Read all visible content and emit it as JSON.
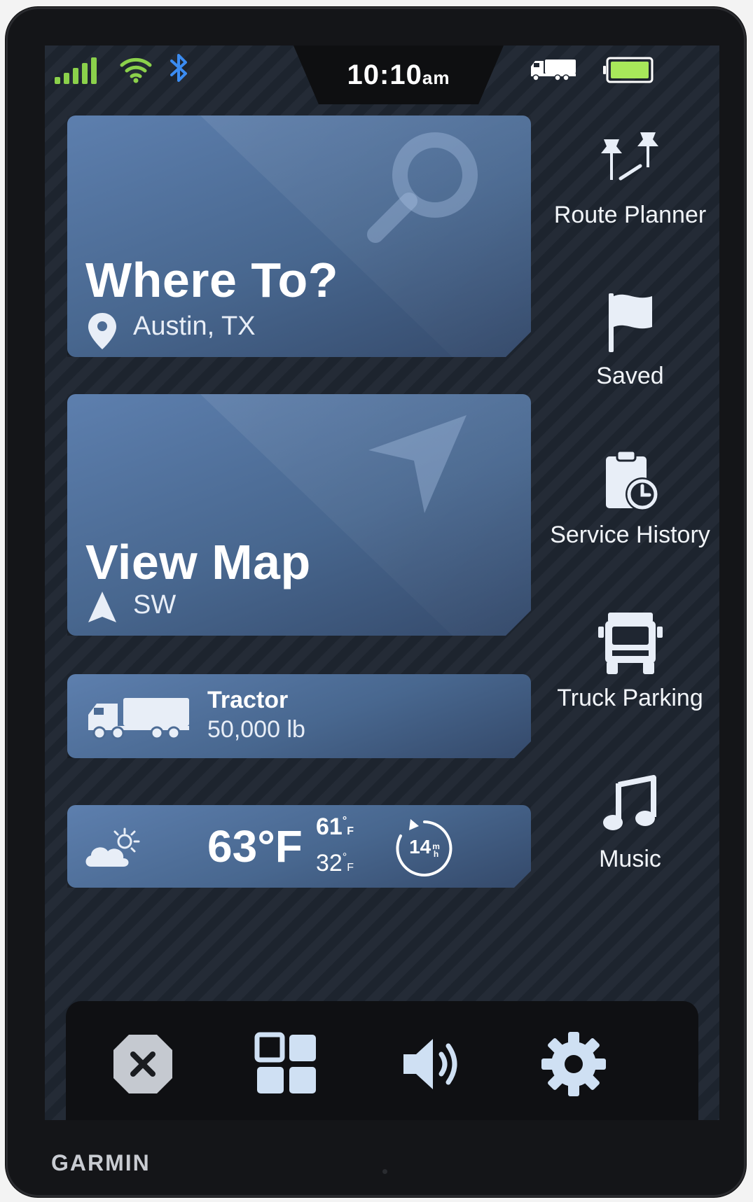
{
  "status_bar": {
    "time": "10:10",
    "time_suffix": "am",
    "icons": [
      "signal-icon",
      "wifi-icon",
      "bluetooth-icon",
      "truck-icon",
      "battery-icon"
    ]
  },
  "cards": {
    "where_to": {
      "title": "Where To?",
      "location": "Austin, TX"
    },
    "view_map": {
      "title": "View Map",
      "heading": "SW"
    },
    "vehicle": {
      "name": "Tractor",
      "weight": "50,000 lb"
    },
    "weather": {
      "temp": "63°F",
      "high": "61",
      "low": "32",
      "unit": "F",
      "timer_value": "14",
      "timer_unit_top": "m",
      "timer_unit_bottom": "h"
    }
  },
  "sidebar": {
    "items": [
      {
        "label": "Route Planner",
        "icon": "pushpin-route-icon"
      },
      {
        "label": "Saved",
        "icon": "flag-icon"
      },
      {
        "label": "Service History",
        "icon": "clipboard-clock-icon"
      },
      {
        "label": "Truck Parking",
        "icon": "truck-front-icon"
      },
      {
        "label": "Music",
        "icon": "music-note-icon"
      }
    ]
  },
  "dock": {
    "items": [
      "close-icon",
      "apps-grid-icon",
      "volume-icon",
      "settings-gear-icon"
    ]
  },
  "brand": "GARMIN",
  "colors": {
    "signal": "#8bd14b",
    "bluetooth": "#3b8cf2",
    "battery": "#a8e85a",
    "card_top": "#5d7fae",
    "background": "#1f2631"
  }
}
